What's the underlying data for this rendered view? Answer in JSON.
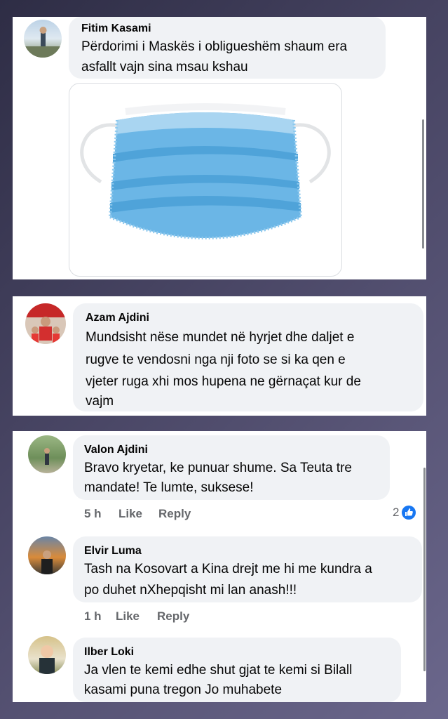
{
  "comments": [
    {
      "name": "Fitim Kasami",
      "line1": "Përdorimi i Maskës i obligueshëm shaum era",
      "line2": "asfallt vajn sina msau kshau",
      "image_icon": "surgical-mask-image"
    },
    {
      "name": "Azam Ajdini",
      "line1": "Mundsisht nëse mundet në hyrjet dhe daljet e",
      "line2": "rugve te vendosni nga nji foto se si ka qen e",
      "line3": "vjeter ruga xhi mos hupena ne gërnaçat kur de",
      "line4": "vajm"
    },
    {
      "name": "Valon Ajdini",
      "line1": "Bravo kryetar, ke punuar shume. Sa Teuta tre",
      "line2": "mandate! Te lumte, suksese!",
      "time": "5 h",
      "like": "Like",
      "reply": "Reply",
      "reactions": "2"
    },
    {
      "name": "Elvir Luma",
      "line1": "Tash na Kosovart a Kina drejt me hi me kundra a",
      "line2": "po duhet nXhepqisht mi lan anash!!!",
      "time": "1 h",
      "like": "Like",
      "reply": "Reply"
    },
    {
      "name": "Ilber Loki",
      "line1": "Ja vlen te kemi edhe shut gjat te kemi si Bilall",
      "line2": "kasami puna tregon Jo muhabete"
    }
  ],
  "colors": {
    "bubble": "#f0f2f5",
    "meta": "#65676b",
    "like_blue": "#1877f2",
    "mask": "#6bb6e6"
  }
}
